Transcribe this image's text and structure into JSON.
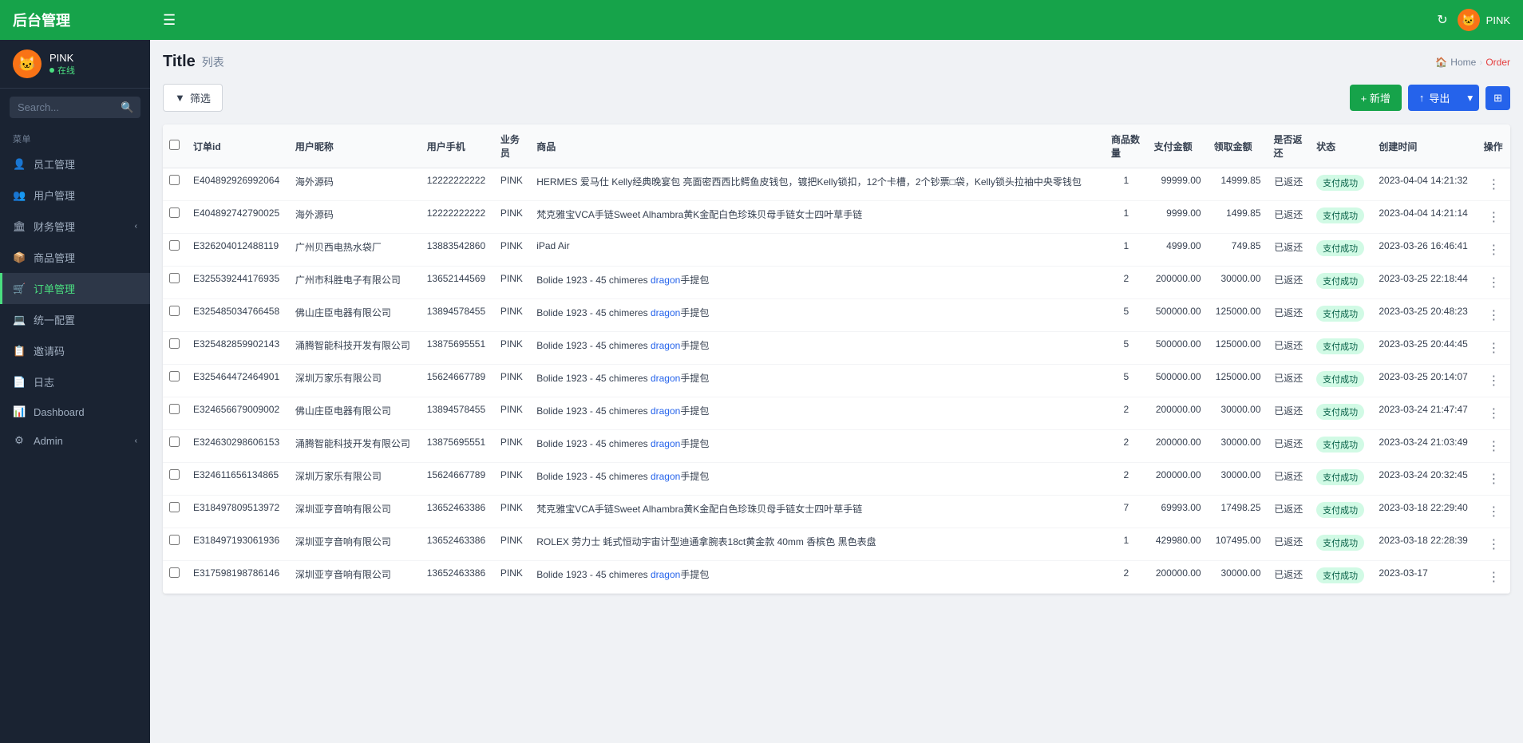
{
  "app": {
    "title": "后台管理",
    "menu_icon": "☰"
  },
  "topbar": {
    "refresh_icon": "↻",
    "user_label": "PINK"
  },
  "sidebar": {
    "user": {
      "name": "PINK",
      "status": "在线"
    },
    "search_placeholder": "Search...",
    "section_label": "菜单",
    "nav_items": [
      {
        "id": "staff",
        "label": "员工管理",
        "icon": "👤",
        "active": false,
        "has_arrow": false
      },
      {
        "id": "user",
        "label": "用户管理",
        "icon": "👥",
        "active": false,
        "has_arrow": false
      },
      {
        "id": "finance",
        "label": "财务管理",
        "icon": "🏛",
        "active": false,
        "has_arrow": true
      },
      {
        "id": "product",
        "label": "商品管理",
        "icon": "📦",
        "active": false,
        "has_arrow": false
      },
      {
        "id": "order",
        "label": "订单管理",
        "icon": "🛒",
        "active": true,
        "has_arrow": false
      },
      {
        "id": "config",
        "label": "统一配置",
        "icon": "💻",
        "active": false,
        "has_arrow": false
      },
      {
        "id": "invite",
        "label": "邀请码",
        "icon": "📋",
        "active": false,
        "has_arrow": false
      },
      {
        "id": "log",
        "label": "日志",
        "icon": "📄",
        "active": false,
        "has_arrow": false
      },
      {
        "id": "dashboard",
        "label": "Dashboard",
        "icon": "📊",
        "active": false,
        "has_arrow": false
      },
      {
        "id": "admin",
        "label": "Admin",
        "icon": "⚙",
        "active": false,
        "has_arrow": true
      }
    ]
  },
  "page": {
    "title": "Title",
    "subtitle": "列表",
    "breadcrumb": {
      "home": "Home",
      "current": "Order"
    }
  },
  "toolbar": {
    "filter_label": "筛选",
    "new_label": "+ 新增",
    "export_label": "导出",
    "cols_icon": "⊞"
  },
  "table": {
    "headers": {
      "order_id": "订单id",
      "user_name": "用户昵称",
      "user_phone": "用户手机",
      "sales": "业务员",
      "product": "商品",
      "qty": "商品数量",
      "payment": "支付金额",
      "pickup": "领取金额",
      "returned": "是否返还",
      "status": "状态",
      "created": "创建时间",
      "action": "操作"
    },
    "rows": [
      {
        "order_id": "E404892926992064",
        "user_name": "海外源码",
        "phone": "12222222222",
        "sales": "PINK",
        "product": "HERMES 爱马仕 Kelly经典晚宴包 亮面密西西比鳄鱼皮钱包，镀把Kelly锁扣，12个卡槽，2个钞票□袋，Kelly锁头拉袖中央零钱包",
        "qty": "1",
        "payment": "99999.00",
        "pickup": "14999.85",
        "returned": "已返还",
        "status": "支付成功",
        "created": "2023-04-04 14:21:32"
      },
      {
        "order_id": "E404892742790025",
        "user_name": "海外源码",
        "phone": "12222222222",
        "sales": "PINK",
        "product": "梵克雅宝VCA手链Sweet Alhambra黄K金配白色珍珠贝母手链女士四叶草手链",
        "qty": "1",
        "payment": "9999.00",
        "pickup": "1499.85",
        "returned": "已返还",
        "status": "支付成功",
        "created": "2023-04-04 14:21:14"
      },
      {
        "order_id": "E326204012488119",
        "user_name": "广州贝西电热水袋厂",
        "phone": "13883542860",
        "sales": "PINK",
        "product": "iPad Air",
        "qty": "1",
        "payment": "4999.00",
        "pickup": "749.85",
        "returned": "已返还",
        "status": "支付成功",
        "created": "2023-03-26 16:46:41"
      },
      {
        "order_id": "E325539244176935",
        "user_name": "广州市科胜电子有限公司",
        "phone": "13652144569",
        "sales": "PINK",
        "product": "Bolide 1923 - 45 chimeres dragon手提包",
        "qty": "2",
        "payment": "200000.00",
        "pickup": "30000.00",
        "returned": "已返还",
        "status": "支付成功",
        "created": "2023-03-25 22:18:44"
      },
      {
        "order_id": "E325485034766458",
        "user_name": "佛山庄臣电器有限公司",
        "phone": "13894578455",
        "sales": "PINK",
        "product": "Bolide 1923 - 45 chimeres dragon手提包",
        "qty": "5",
        "payment": "500000.00",
        "pickup": "125000.00",
        "returned": "已返还",
        "status": "支付成功",
        "created": "2023-03-25 20:48:23"
      },
      {
        "order_id": "E325482859902143",
        "user_name": "涌腾智能科技开发有限公司",
        "phone": "13875695551",
        "sales": "PINK",
        "product": "Bolide 1923 - 45 chimeres dragon手提包",
        "qty": "5",
        "payment": "500000.00",
        "pickup": "125000.00",
        "returned": "已返还",
        "status": "支付成功",
        "created": "2023-03-25 20:44:45"
      },
      {
        "order_id": "E325464472464901",
        "user_name": "深圳万家乐有限公司",
        "phone": "15624667789",
        "sales": "PINK",
        "product": "Bolide 1923 - 45 chimeres dragon手提包",
        "qty": "5",
        "payment": "500000.00",
        "pickup": "125000.00",
        "returned": "已返还",
        "status": "支付成功",
        "created": "2023-03-25 20:14:07"
      },
      {
        "order_id": "E324656679009002",
        "user_name": "佛山庄臣电器有限公司",
        "phone": "13894578455",
        "sales": "PINK",
        "product": "Bolide 1923 - 45 chimeres dragon手提包",
        "qty": "2",
        "payment": "200000.00",
        "pickup": "30000.00",
        "returned": "已返还",
        "status": "支付成功",
        "created": "2023-03-24 21:47:47"
      },
      {
        "order_id": "E324630298606153",
        "user_name": "涌腾智能科技开发有限公司",
        "phone": "13875695551",
        "sales": "PINK",
        "product": "Bolide 1923 - 45 chimeres dragon手提包",
        "qty": "2",
        "payment": "200000.00",
        "pickup": "30000.00",
        "returned": "已返还",
        "status": "支付成功",
        "created": "2023-03-24 21:03:49"
      },
      {
        "order_id": "E324611656134865",
        "user_name": "深圳万家乐有限公司",
        "phone": "15624667789",
        "sales": "PINK",
        "product": "Bolide 1923 - 45 chimeres dragon手提包",
        "qty": "2",
        "payment": "200000.00",
        "pickup": "30000.00",
        "returned": "已返还",
        "status": "支付成功",
        "created": "2023-03-24 20:32:45"
      },
      {
        "order_id": "E318497809513972",
        "user_name": "深圳亚亨音响有限公司",
        "phone": "13652463386",
        "sales": "PINK",
        "product": "梵克雅宝VCA手链Sweet Alhambra黄K金配白色珍珠贝母手链女士四叶草手链",
        "qty": "7",
        "payment": "69993.00",
        "pickup": "17498.25",
        "returned": "已返还",
        "status": "支付成功",
        "created": "2023-03-18 22:29:40"
      },
      {
        "order_id": "E318497193061936",
        "user_name": "深圳亚亨音响有限公司",
        "phone": "13652463386",
        "sales": "PINK",
        "product": "ROLEX 劳力士 蚝式恒动宇宙计型迪通拿腕表18ct黄金款 40mm 香槟色 黑色表盘",
        "qty": "1",
        "payment": "429980.00",
        "pickup": "107495.00",
        "returned": "已返还",
        "status": "支付成功",
        "created": "2023-03-18 22:28:39"
      },
      {
        "order_id": "E317598198786146",
        "user_name": "深圳亚亨音响有限公司",
        "phone": "13652463386",
        "sales": "PINK",
        "product": "Bolide 1923 - 45 chimeres dragon手提包",
        "qty": "2",
        "payment": "200000.00",
        "pickup": "30000.00",
        "returned": "已返还",
        "status": "支付成功",
        "created": "2023-03-17"
      }
    ]
  }
}
